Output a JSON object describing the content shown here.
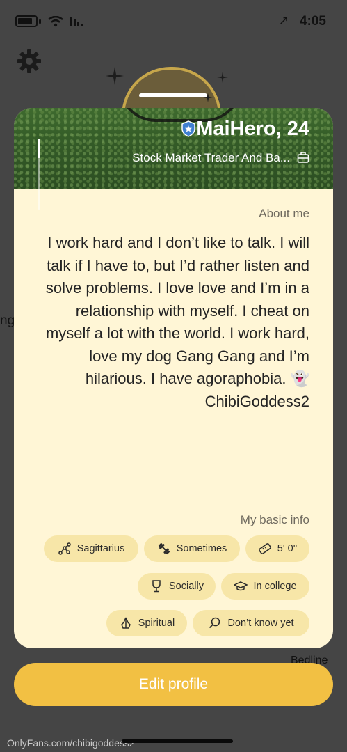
{
  "status_bar": {
    "time": "4:05",
    "arrow": "↗"
  },
  "profile": {
    "name": "MaiHero, 24",
    "occupation": "Stock Market Trader And Ba...",
    "about_label": "About me",
    "bio": "I work hard and I don’t like to talk. I will talk if I have to, but I’d rather listen and solve problems. I love love and I’m in a relationship with myself. I cheat on myself a lot with the world. I work hard, love my dog Gang Gang and I’m hilarious. I have agoraphobia. 👻 ChibiGoddess2",
    "basic_info_label": "My basic info",
    "chips": [
      {
        "icon": "ruler-icon",
        "label": "5' 0''"
      },
      {
        "icon": "dumbbell-icon",
        "label": "Sometimes"
      },
      {
        "icon": "zodiac-icon",
        "label": "Sagittarius"
      },
      {
        "icon": "graduation-cap-icon",
        "label": "In college"
      },
      {
        "icon": "wine-glass-icon",
        "label": "Socially"
      },
      {
        "icon": "search-icon",
        "label": "Don’t know yet"
      },
      {
        "icon": "praying-hands-icon",
        "label": "Spiritual"
      }
    ]
  },
  "background": {
    "left_text": "ng",
    "bottom_text": "Bedline"
  },
  "edit_button_label": "Edit profile",
  "watermark": "OnlyFans.com/chibigoddess2",
  "colors": {
    "card": "#fff6d6",
    "chip": "#f7e6a8",
    "button": "#f2c043",
    "overlay": "#454545"
  }
}
